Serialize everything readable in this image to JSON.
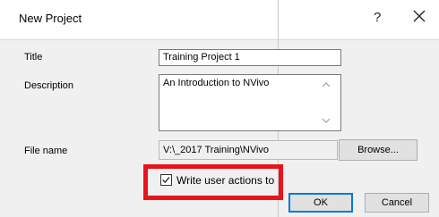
{
  "dialog": {
    "title": "New Project",
    "title_label": "Title",
    "title_value": "Training Project 1",
    "description_label": "Description",
    "description_value": "An Introduction to NVivo",
    "filename_label": "File name",
    "filename_value": "V:\\_2017 Training\\NVivo",
    "browse_label": "Browse...",
    "write_actions_label": "Write user actions to",
    "write_actions_checked": true
  },
  "back_dialog": {
    "help_label": "?",
    "ok_label": "OK",
    "cancel_label": "Cancel"
  },
  "colors": {
    "highlight": "#e8141c",
    "default_button_border": "#0078d7",
    "dialog_bg": "#f0f0f0"
  },
  "icons": {
    "close": "close-icon",
    "help": "help-icon",
    "check": "checkmark-icon",
    "scroll_up": "chevron-up-icon",
    "scroll_down": "chevron-down-icon"
  }
}
